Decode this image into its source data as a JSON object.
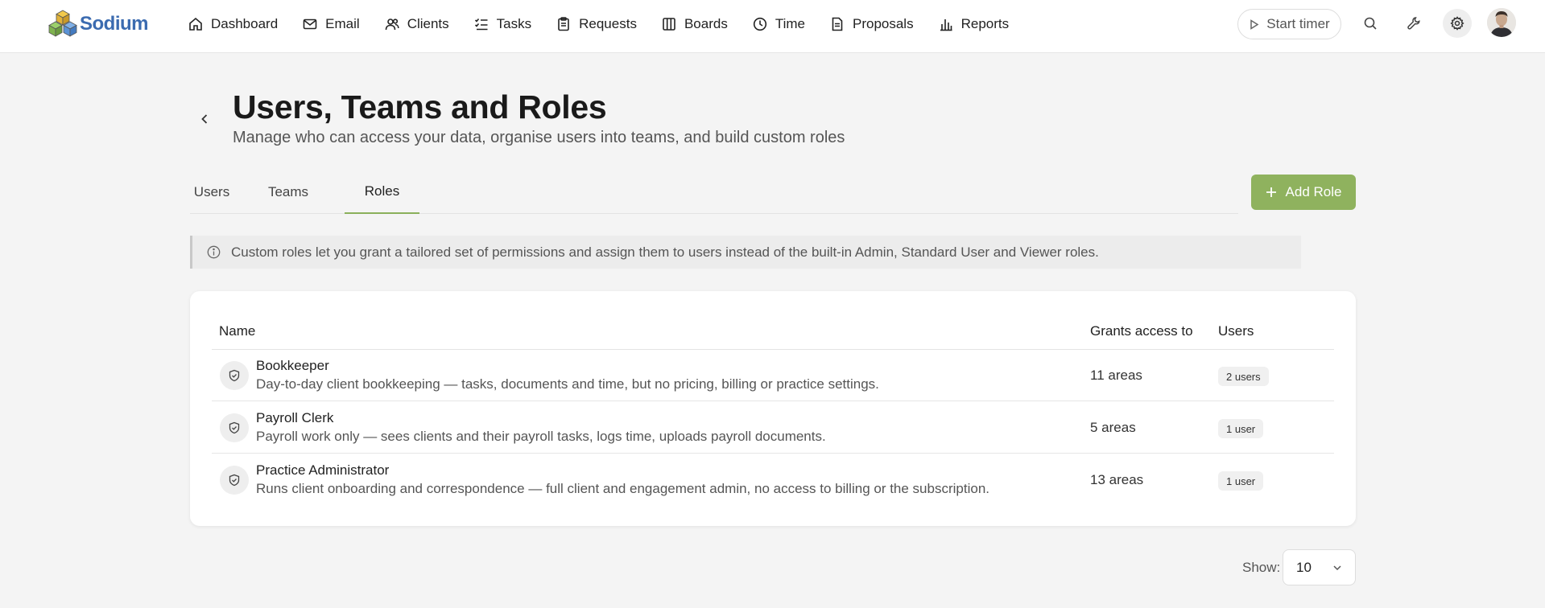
{
  "brand": {
    "name": "Sodium"
  },
  "nav": {
    "items": [
      {
        "label": "Dashboard",
        "icon": "home-icon"
      },
      {
        "label": "Email",
        "icon": "mail-icon"
      },
      {
        "label": "Clients",
        "icon": "users-icon"
      },
      {
        "label": "Tasks",
        "icon": "checklist-icon"
      },
      {
        "label": "Requests",
        "icon": "clipboard-icon"
      },
      {
        "label": "Boards",
        "icon": "columns-icon"
      },
      {
        "label": "Time",
        "icon": "clock-icon"
      },
      {
        "label": "Proposals",
        "icon": "document-icon"
      },
      {
        "label": "Reports",
        "icon": "bar-chart-icon"
      }
    ],
    "start_timer": "Start timer"
  },
  "header": {
    "title": "Users, Teams and Roles",
    "subtitle": "Manage who can access your data, organise users into teams, and build custom roles"
  },
  "tabs": [
    {
      "label": "Users",
      "active": false
    },
    {
      "label": "Teams",
      "active": false
    },
    {
      "label": "Roles",
      "active": true
    }
  ],
  "actions": {
    "add_role": "Add Role"
  },
  "info_banner": "Custom roles let you grant a tailored set of permissions and assign them to users instead of the built-in Admin, Standard User and Viewer roles.",
  "table": {
    "headers": {
      "name": "Name",
      "grants": "Grants access to",
      "users": "Users"
    },
    "rows": [
      {
        "name": "Bookkeeper",
        "description": "Day-to-day client bookkeeping — tasks, documents and time, but no pricing, billing or practice settings.",
        "grants": "11 areas",
        "users": "2 users"
      },
      {
        "name": "Payroll Clerk",
        "description": "Payroll work only — sees clients and their payroll tasks, logs time, uploads payroll documents.",
        "grants": "5 areas",
        "users": "1 user"
      },
      {
        "name": "Practice Administrator",
        "description": "Runs client onboarding and correspondence — full client and engagement admin, no access to billing or the subscription.",
        "grants": "13 areas",
        "users": "1 user"
      }
    ]
  },
  "pagination": {
    "show_label": "Show:",
    "page_size": "10"
  },
  "colors": {
    "accent": "#8fb25e",
    "brand_blue": "#3b6bb0"
  }
}
